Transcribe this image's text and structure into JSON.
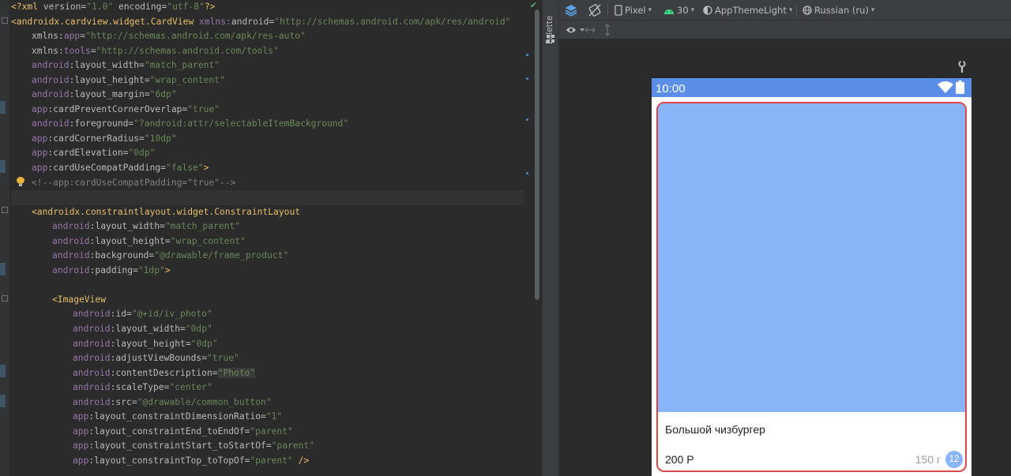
{
  "editor": {
    "lines": [
      {
        "indent": 0,
        "tokens": [
          [
            "tag",
            "<?xml "
          ],
          [
            "attr",
            "version="
          ],
          [
            "val",
            "\"1.0\""
          ],
          [
            "attr",
            " encoding="
          ],
          [
            "val",
            "\"utf-8\""
          ],
          [
            "tag",
            "?>"
          ]
        ]
      },
      {
        "indent": 0,
        "tokens": [
          [
            "tag",
            "<androidx.cardview.widget.CardView "
          ],
          [
            "ns",
            "xmlns:"
          ],
          [
            "attr",
            "android="
          ],
          [
            "val",
            "\"http://schemas.android.com/apk/res/android\""
          ]
        ]
      },
      {
        "indent": 1,
        "tokens": [
          [
            "attr",
            "xmlns:"
          ],
          [
            "ns",
            "app"
          ],
          [
            "attr",
            "="
          ],
          [
            "val",
            "\"http://schemas.android.com/apk/res-auto\""
          ]
        ]
      },
      {
        "indent": 1,
        "tokens": [
          [
            "attr",
            "xmlns:"
          ],
          [
            "ns",
            "tools"
          ],
          [
            "attr",
            "="
          ],
          [
            "val",
            "\"http://schemas.android.com/tools\""
          ]
        ]
      },
      {
        "indent": 1,
        "tokens": [
          [
            "ns",
            "android"
          ],
          [
            "attr",
            ":layout_width="
          ],
          [
            "val",
            "\"match_parent\""
          ]
        ]
      },
      {
        "indent": 1,
        "tokens": [
          [
            "ns",
            "android"
          ],
          [
            "attr",
            ":layout_height="
          ],
          [
            "val",
            "\"wrap_content\""
          ]
        ]
      },
      {
        "indent": 1,
        "tokens": [
          [
            "ns",
            "android"
          ],
          [
            "attr",
            ":layout_margin="
          ],
          [
            "val",
            "\"6dp\""
          ]
        ]
      },
      {
        "indent": 1,
        "tokens": [
          [
            "ns",
            "app"
          ],
          [
            "attr",
            ":cardPreventCornerOverlap="
          ],
          [
            "val",
            "\"true\""
          ]
        ]
      },
      {
        "indent": 1,
        "tokens": [
          [
            "ns",
            "android"
          ],
          [
            "attr",
            ":foreground="
          ],
          [
            "val",
            "\"?android:attr/selectableItemBackground\""
          ]
        ]
      },
      {
        "indent": 1,
        "tokens": [
          [
            "ns",
            "app"
          ],
          [
            "attr",
            ":cardCornerRadius="
          ],
          [
            "val",
            "\"10dp\""
          ]
        ]
      },
      {
        "indent": 1,
        "tokens": [
          [
            "ns",
            "app"
          ],
          [
            "attr",
            ":cardElevation="
          ],
          [
            "val",
            "\"0dp\""
          ]
        ]
      },
      {
        "indent": 1,
        "tokens": [
          [
            "ns",
            "app"
          ],
          [
            "attr",
            ":cardUseCompatPadding="
          ],
          [
            "val",
            "\"false\""
          ],
          [
            "tag",
            ">"
          ]
        ]
      },
      {
        "indent": 1,
        "tokens": [
          [
            "comment",
            "<!--app:cardUseCompatPadding=\"true\"-->"
          ]
        ]
      },
      {
        "indent": 0,
        "tokens": [],
        "current": true
      },
      {
        "indent": 1,
        "tokens": [
          [
            "tag",
            "<androidx.constraintlayout.widget.ConstraintLayout"
          ]
        ]
      },
      {
        "indent": 2,
        "tokens": [
          [
            "ns",
            "android"
          ],
          [
            "attr",
            ":layout_width="
          ],
          [
            "val",
            "\"match_parent\""
          ]
        ]
      },
      {
        "indent": 2,
        "tokens": [
          [
            "ns",
            "android"
          ],
          [
            "attr",
            ":layout_height="
          ],
          [
            "val",
            "\"wrap_content\""
          ]
        ]
      },
      {
        "indent": 2,
        "tokens": [
          [
            "ns",
            "android"
          ],
          [
            "attr",
            ":background="
          ],
          [
            "val",
            "\"@drawable/frame_product\""
          ]
        ]
      },
      {
        "indent": 2,
        "tokens": [
          [
            "ns",
            "android"
          ],
          [
            "attr",
            ":padding="
          ],
          [
            "val",
            "\"1dp\""
          ],
          [
            "tag",
            ">"
          ]
        ]
      },
      {
        "indent": 0,
        "tokens": []
      },
      {
        "indent": 2,
        "tokens": [
          [
            "tag",
            "<ImageView"
          ]
        ]
      },
      {
        "indent": 3,
        "tokens": [
          [
            "ns",
            "android"
          ],
          [
            "attr",
            ":id="
          ],
          [
            "val",
            "\"@+id/iv_photo\""
          ]
        ]
      },
      {
        "indent": 3,
        "tokens": [
          [
            "ns",
            "android"
          ],
          [
            "attr",
            ":layout_width="
          ],
          [
            "val",
            "\"0dp\""
          ]
        ]
      },
      {
        "indent": 3,
        "tokens": [
          [
            "ns",
            "android"
          ],
          [
            "attr",
            ":layout_height="
          ],
          [
            "val",
            "\"0dp\""
          ]
        ]
      },
      {
        "indent": 3,
        "tokens": [
          [
            "ns",
            "android"
          ],
          [
            "attr",
            ":adjustViewBounds="
          ],
          [
            "val",
            "\"true\""
          ]
        ]
      },
      {
        "indent": 3,
        "tokens": [
          [
            "ns",
            "android"
          ],
          [
            "attr",
            ":contentDescription="
          ],
          [
            "hl",
            "\"Photo\""
          ]
        ]
      },
      {
        "indent": 3,
        "tokens": [
          [
            "ns",
            "android"
          ],
          [
            "attr",
            ":scaleType="
          ],
          [
            "val",
            "\"center\""
          ]
        ]
      },
      {
        "indent": 3,
        "tokens": [
          [
            "ns",
            "android"
          ],
          [
            "attr",
            ":src="
          ],
          [
            "val",
            "\"@drawable/common_button\""
          ]
        ]
      },
      {
        "indent": 3,
        "tokens": [
          [
            "ns",
            "app"
          ],
          [
            "attr",
            ":layout_constraintDimensionRatio="
          ],
          [
            "val",
            "\"1\""
          ]
        ]
      },
      {
        "indent": 3,
        "tokens": [
          [
            "ns",
            "app"
          ],
          [
            "attr",
            ":layout_constraintEnd_toEndOf="
          ],
          [
            "val",
            "\"parent\""
          ]
        ]
      },
      {
        "indent": 3,
        "tokens": [
          [
            "ns",
            "app"
          ],
          [
            "attr",
            ":layout_constraintStart_toStartOf="
          ],
          [
            "val",
            "\"parent\""
          ]
        ]
      },
      {
        "indent": 3,
        "tokens": [
          [
            "ns",
            "app"
          ],
          [
            "attr",
            ":layout_constraintTop_toTopOf="
          ],
          [
            "val",
            "\"parent\""
          ],
          [
            "tag",
            " />"
          ]
        ]
      }
    ]
  },
  "palette": {
    "label": "Palette",
    "icon": "palette-icon"
  },
  "toolbar": {
    "device": "Pixel",
    "api": "30",
    "theme": "AppThemeLight",
    "locale": "Russian (ru)"
  },
  "preview": {
    "time": "10:00",
    "product_name": "Большой чизбургер",
    "price": "200 Р",
    "weight": "150 г",
    "badge": "12",
    "colors": {
      "status_bar": "#5b8ee6",
      "photo": "#8ab4f8",
      "card_border": "#d9474b"
    }
  }
}
